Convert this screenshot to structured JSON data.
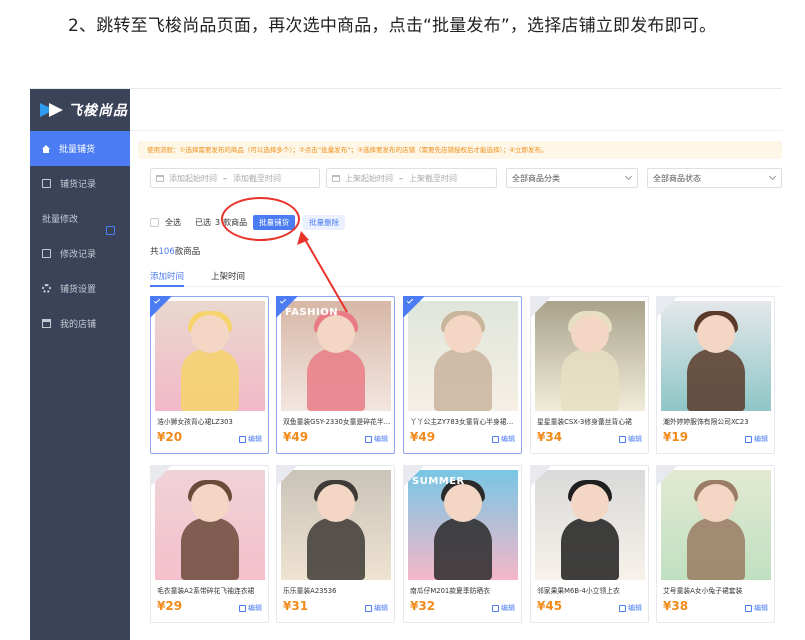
{
  "instruction": "2、跳转至飞梭尚品页面，再次选中商品，点击“批量发布”，选择店铺立即发布即可。",
  "app": {
    "logo_text": "飞梭尚品",
    "sidebar": [
      {
        "label": "批量铺货",
        "icon": "home-icon",
        "active": true
      },
      {
        "label": "铺货记录",
        "icon": "document-icon",
        "active": false
      },
      {
        "label": "批量修改",
        "icon": "edit-icon",
        "active": false
      },
      {
        "label": "修改记录",
        "icon": "record-icon",
        "active": false
      },
      {
        "label": "铺货设置",
        "icon": "gear-icon",
        "active": false
      },
      {
        "label": "我的店铺",
        "icon": "shop-icon",
        "active": false
      }
    ],
    "tip": "使用流程：①选择需要发布的商品（可以选择多个）；②点击“批量发布”；③选择要发布的店铺（需要先店铺授权后才能选择）；④立即发布。",
    "filters": {
      "add_time_start": "添加起始时间",
      "add_time_end": "添加截至时间",
      "range_sep": "–",
      "shelf_time_start": "上架起始时间",
      "shelf_time_end": "上架截至时间",
      "category": "全部商品分类",
      "status": "全部商品状态"
    },
    "batch": {
      "select_all": "全选",
      "selected_prefix": "已选",
      "selected_count": "3",
      "selected_suffix": "款商品",
      "publish_button": "批量铺货",
      "delete_button": "批量删除"
    },
    "count": {
      "prefix": "共",
      "number": "106",
      "suffix": "款商品"
    },
    "tabs": [
      "添加时间",
      "上架时间"
    ],
    "edit_label": "编辑",
    "products": [
      {
        "name": "浩小狮女孩背心裙LZ303",
        "price": "¥20",
        "selected": true,
        "colors": [
          "#e9d8cf",
          "#f2b8c8",
          "#f6d36b"
        ]
      },
      {
        "name": "双鱼童装GSY-2330女童是碎花半身裙",
        "price": "¥49",
        "selected": true,
        "colors": [
          "#d7b7a6",
          "#f3e6e0",
          "#e97b86"
        ],
        "overlay": "FASHION"
      },
      {
        "name": "丫丫公主ZY783女童背心半身裙套装",
        "price": "¥49",
        "selected": true,
        "colors": [
          "#dfe6dc",
          "#f6efe4",
          "#c9b49c"
        ]
      },
      {
        "name": "星星童装CSX-3修身蕾丝背心裙",
        "price": "¥34",
        "selected": false,
        "colors": [
          "#a9a38c",
          "#f1ecd9",
          "#e6dfc3"
        ]
      },
      {
        "name": "潮外婷婷服饰有限公司XC23",
        "price": "¥19",
        "selected": false,
        "colors": [
          "#e4e7ea",
          "#8fc6c6",
          "#5a3b2a"
        ]
      },
      {
        "name": "毛衣童装A2系带碎花飞袖连衣裙",
        "price": "¥29",
        "selected": false,
        "colors": [
          "#efd2d7",
          "#f4c0cc",
          "#6b4a3a"
        ]
      },
      {
        "name": "乐乐童装A23536",
        "price": "¥31",
        "selected": false,
        "colors": [
          "#c9c3b8",
          "#efe3d1",
          "#3e3a36"
        ]
      },
      {
        "name": "南瓜仔M201款夏季防晒衣",
        "price": "¥32",
        "selected": false,
        "colors": [
          "#78c6e4",
          "#f5b7c8",
          "#2a2a2a"
        ],
        "overlay": "SUMMER"
      },
      {
        "name": "邻家果果M6B-4小立领上衣",
        "price": "¥45",
        "selected": false,
        "colors": [
          "#d9d9d9",
          "#f7f2ea",
          "#1f1f1f"
        ]
      },
      {
        "name": "艾号童装A女小兔子裙套装",
        "price": "¥38",
        "selected": false,
        "colors": [
          "#e3e9d2",
          "#bfe0c0",
          "#9a7b63"
        ]
      }
    ]
  }
}
